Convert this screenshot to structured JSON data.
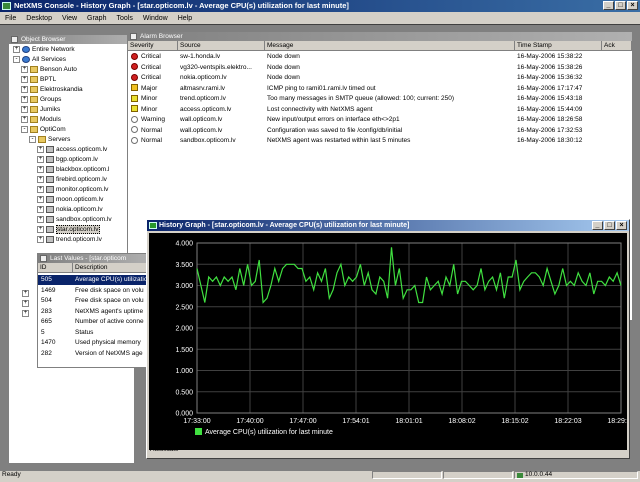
{
  "app": {
    "title": "NetXMS Console - History Graph - [star.opticom.lv - Average CPU(s) utilization for last minute]"
  },
  "menu": [
    "File",
    "Desktop",
    "View",
    "Graph",
    "Tools",
    "Window",
    "Help"
  ],
  "object_browser": {
    "title": "Object Browser",
    "items": [
      {
        "label": "Entire Network",
        "exp": "+",
        "icon": "globe"
      },
      {
        "label": "All Services",
        "exp": "-",
        "icon": "globe"
      },
      {
        "label": "Benson Auto",
        "exp": "+",
        "icon": "folder"
      },
      {
        "label": "BPTL",
        "exp": "+",
        "icon": "folder"
      },
      {
        "label": "Elektroskandia",
        "exp": "+",
        "icon": "folder"
      },
      {
        "label": "Groups",
        "exp": "+",
        "icon": "folder"
      },
      {
        "label": "Jumiks",
        "exp": "+",
        "icon": "folder"
      },
      {
        "label": "Moduls",
        "exp": "+",
        "icon": "folder"
      },
      {
        "label": "OptiCom",
        "exp": "-",
        "icon": "folder"
      },
      {
        "label": "Servers",
        "exp": "-",
        "icon": "folder"
      },
      {
        "label": "access.opticom.lv",
        "exp": "+",
        "icon": "srv"
      },
      {
        "label": "bgp.opticom.lv",
        "exp": "+",
        "icon": "srv"
      },
      {
        "label": "blackbox.opticom.l",
        "exp": "+",
        "icon": "srv"
      },
      {
        "label": "firebird.opticom.lv",
        "exp": "+",
        "icon": "srv"
      },
      {
        "label": "monitor.opticom.lv",
        "exp": "+",
        "icon": "srv"
      },
      {
        "label": "moon.opticom.lv",
        "exp": "+",
        "icon": "srv"
      },
      {
        "label": "nokia.opticom.lv",
        "exp": "+",
        "icon": "srv"
      },
      {
        "label": "sandbox.opticom.lv",
        "exp": "+",
        "icon": "srv"
      },
      {
        "label": "star.opticom.lv",
        "exp": "+",
        "icon": "srv",
        "selected": true
      },
      {
        "label": "trend.opticom.lv",
        "exp": "+",
        "icon": "srv"
      }
    ]
  },
  "alarm_browser": {
    "title": "Alarm Browser",
    "columns": [
      "Severity",
      "Source",
      "Message",
      "Time Stamp",
      "Ack"
    ],
    "rows": [
      {
        "sev": "critical",
        "severity": "Critical",
        "source": "sw-1.honda.lv",
        "message": "Node down",
        "time": "16-May-2006 15:38:22"
      },
      {
        "sev": "critical",
        "severity": "Critical",
        "source": "vg320-ventspils.elektro...",
        "message": "Node down",
        "time": "16-May-2006 15:38:26"
      },
      {
        "sev": "critical",
        "severity": "Critical",
        "source": "nokia.opticom.lv",
        "message": "Node down",
        "time": "16-May-2006 15:36:32"
      },
      {
        "sev": "major",
        "severity": "Major",
        "source": "altmasrv.rami.lv",
        "message": "ICMP ping to rami01.rami.lv timed out",
        "time": "16-May-2006 17:17:47"
      },
      {
        "sev": "minor",
        "severity": "Minor",
        "source": "trend.opticom.lv",
        "message": "Too many messages in SMTP queue (allowed: 100; current: 250)",
        "time": "16-May-2006 15:43:18"
      },
      {
        "sev": "minor",
        "severity": "Minor",
        "source": "access.opticom.lv",
        "message": "Lost connectivity with NetXMS agent",
        "time": "16-May-2006 15:44:09"
      },
      {
        "sev": "warning",
        "severity": "Warning",
        "source": "wall.opticom.lv",
        "message": "New input/output errors on interface eth<>2p1",
        "time": "16-May-2006 18:26:58"
      },
      {
        "sev": "normal",
        "severity": "Normal",
        "source": "wall.opticom.lv",
        "message": "Configuration was saved to file /config/db/initial",
        "time": "16-May-2006 17:32:53"
      },
      {
        "sev": "normal",
        "severity": "Normal",
        "source": "sandbox.opticom.lv",
        "message": "NetXMS agent was restarted within last 5 minutes",
        "time": "16-May-2006 18:30:12"
      }
    ]
  },
  "last_values": {
    "title": "Last Values - [star.opticom",
    "columns": [
      "ID",
      "Description"
    ],
    "rows": [
      {
        "id": "505",
        "desc": "Average CPU(s) utilizatio",
        "selected": true
      },
      {
        "id": "1469",
        "desc": "Free disk space on volu"
      },
      {
        "id": "504",
        "desc": "Free disk space on volu"
      },
      {
        "id": "283",
        "desc": "NetXMS agent's uptime"
      },
      {
        "id": "665",
        "desc": "Number of active conne"
      },
      {
        "id": "5",
        "desc": "Status"
      },
      {
        "id": "1470",
        "desc": "Used physical memory"
      },
      {
        "id": "282",
        "desc": "Version of NetXMS age"
      }
    ]
  },
  "history_graph": {
    "title": "History Graph - [star.opticom.lv - Average CPU(s) utilization for last minute]",
    "autoscale_label": "Autoscale",
    "colors": {
      "background": "#000000",
      "grid": "#404040",
      "line": "#40e040",
      "text": "#ffffff"
    }
  },
  "chart_data": {
    "type": "line",
    "title": "",
    "xlabel": "",
    "ylabel": "",
    "ylim": [
      0,
      4.0
    ],
    "y_ticks": [
      "0.000",
      "0.500",
      "1.000",
      "1.500",
      "2.000",
      "2.500",
      "3.000",
      "3.500",
      "4.000"
    ],
    "x_ticks": [
      "17:33:00",
      "17:40:00",
      "17:47:00",
      "17:54:01",
      "18:01:01",
      "18:08:02",
      "18:15:02",
      "18:22:03",
      "18:29:03"
    ],
    "grid": true,
    "legend": "bottom-left",
    "series": [
      {
        "name": "Average CPU(s) utilization for last minute",
        "x_range": [
          "17:33:00",
          "18:29:03"
        ],
        "values": [
          3.4,
          3.0,
          2.6,
          3.2,
          3.1,
          3.2,
          3.0,
          3.2,
          3.1,
          3.2,
          2.9,
          3.4,
          3.0,
          3.5,
          3.0,
          3.1,
          3.6,
          2.6,
          2.7,
          3.0,
          3.4,
          3.1,
          3.4,
          3.5,
          3.5,
          3.5,
          3.4,
          3.4,
          3.1,
          3.2,
          2.9,
          3.3,
          3.1,
          3.4,
          2.7,
          2.9,
          3.3,
          3.5,
          3.0,
          3.2,
          3.1,
          3.2,
          3.5,
          3.0,
          3.3,
          2.9,
          2.8,
          3.2,
          3.1,
          2.7,
          3.9,
          3.0,
          3.4,
          2.7,
          2.9,
          2.9,
          3.0,
          2.6,
          2.6,
          3.2,
          2.9,
          3.0,
          3.1,
          2.8,
          3.2,
          3.0,
          3.5,
          2.8,
          3.1,
          3.1,
          3.0,
          2.9,
          3.0,
          3.4,
          2.9,
          3.1,
          3.2,
          2.9,
          3.3,
          2.7,
          3.2,
          3.2,
          3.6,
          2.9,
          3.1,
          3.2,
          3.3,
          3.3,
          3.2,
          3.0,
          3.4,
          3.1,
          2.8,
          3.0,
          3.4,
          3.0,
          3.1,
          3.0,
          3.3,
          3.1,
          3.0,
          3.3,
          2.8,
          3.1,
          3.1,
          3.0,
          3.2,
          3.1,
          3.3,
          3.0
        ]
      }
    ]
  },
  "status": {
    "left": "Ready",
    "server": "10.0.0.44"
  }
}
